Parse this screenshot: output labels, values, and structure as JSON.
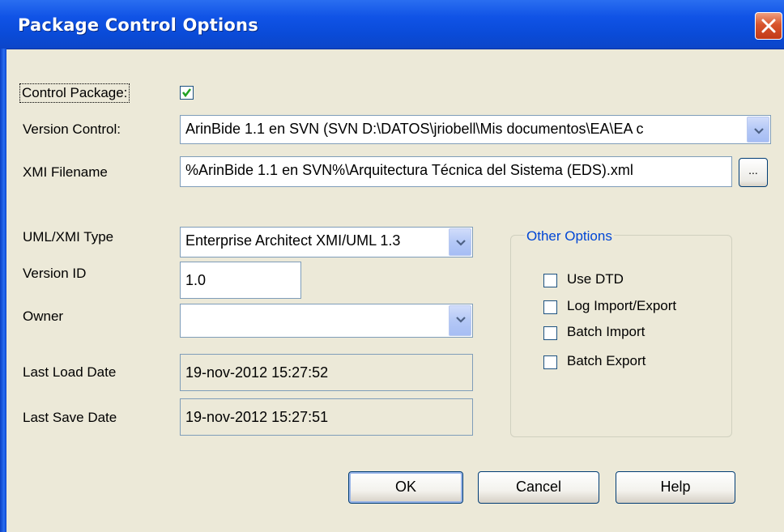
{
  "window": {
    "title": "Package Control Options"
  },
  "control_package": {
    "label": "Control Package:",
    "checked": true
  },
  "version_control": {
    "label": "Version Control:",
    "value": "ArinBide 1.1 en SVN (SVN D:\\DATOS\\jriobell\\Mis documentos\\EA\\EA c"
  },
  "xmi_filename": {
    "label": "XMI Filename",
    "value": "%ArinBide 1.1 en SVN%\\Arquitectura Técnica del  Sistema (EDS).xml",
    "browse_label": "..."
  },
  "uml_xmi_type": {
    "label": "UML/XMI Type",
    "value": "Enterprise Architect XMI/UML 1.3"
  },
  "version_id": {
    "label": "Version ID",
    "value": "1.0"
  },
  "owner": {
    "label": "Owner",
    "value": ""
  },
  "last_load_date": {
    "label": "Last Load Date",
    "value": "19-nov-2012 15:27:52"
  },
  "last_save_date": {
    "label": "Last Save Date",
    "value": "19-nov-2012 15:27:51"
  },
  "other_options": {
    "title": "Other Options",
    "items": [
      {
        "label": "Use DTD",
        "checked": false
      },
      {
        "label": "Log Import/Export",
        "checked": false
      },
      {
        "label": "Batch Import",
        "checked": false
      },
      {
        "label": "Batch Export",
        "checked": false
      }
    ]
  },
  "buttons": {
    "ok": "OK",
    "cancel": "Cancel",
    "help": "Help"
  },
  "colors": {
    "titlebar": "#0a4bd8",
    "dialog_bg": "#ece9d8",
    "group_title": "#0046d5",
    "check": "#21a121"
  }
}
